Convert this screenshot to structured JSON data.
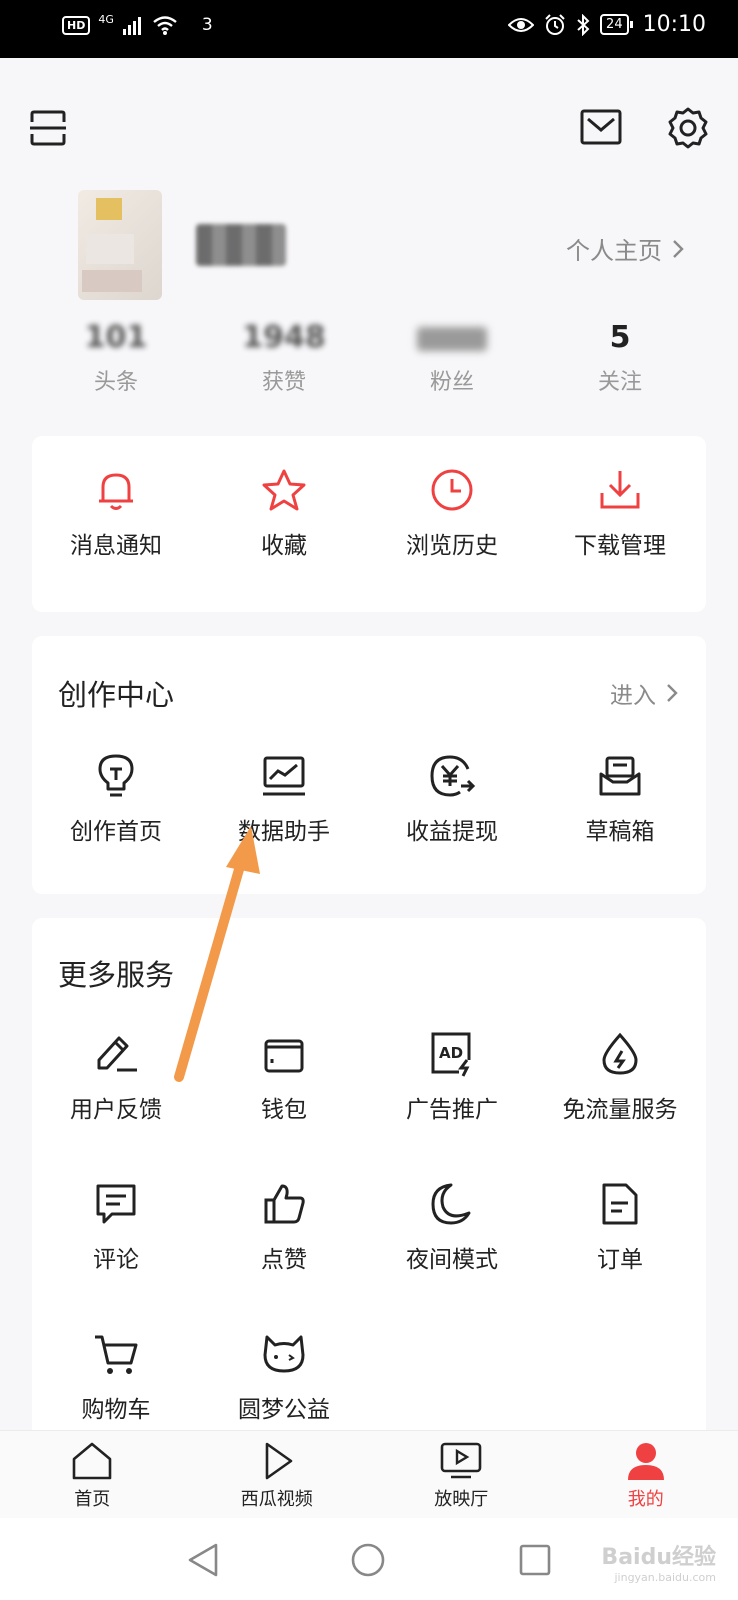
{
  "status_bar": {
    "hd": "HD",
    "network": "4G",
    "sim_count": "3",
    "battery": "24",
    "time": "10:10"
  },
  "profile": {
    "username": "某某",
    "home_link": "个人主页"
  },
  "stats": [
    {
      "value": "101",
      "label": "头条"
    },
    {
      "value": "1948",
      "label": "获赞"
    },
    {
      "value": "",
      "label": "粉丝"
    },
    {
      "value": "5",
      "label": "关注"
    }
  ],
  "quick_actions": [
    {
      "label": "消息通知",
      "icon": "bell-icon"
    },
    {
      "label": "收藏",
      "icon": "star-icon"
    },
    {
      "label": "浏览历史",
      "icon": "clock-icon"
    },
    {
      "label": "下载管理",
      "icon": "download-icon"
    }
  ],
  "creator_center": {
    "title": "创作中心",
    "link": "进入",
    "items": [
      {
        "label": "创作首页",
        "icon": "lightbulb-icon"
      },
      {
        "label": "数据助手",
        "icon": "chart-monitor-icon"
      },
      {
        "label": "收益提现",
        "icon": "yuan-icon"
      },
      {
        "label": "草稿箱",
        "icon": "draft-box-icon"
      }
    ]
  },
  "more_services": {
    "title": "更多服务",
    "items": [
      {
        "label": "用户反馈",
        "icon": "pencil-icon"
      },
      {
        "label": "钱包",
        "icon": "wallet-icon"
      },
      {
        "label": "广告推广",
        "icon": "ad-icon"
      },
      {
        "label": "免流量服务",
        "icon": "drop-icon"
      },
      {
        "label": "评论",
        "icon": "comment-icon"
      },
      {
        "label": "点赞",
        "icon": "thumbs-up-icon"
      },
      {
        "label": "夜间模式",
        "icon": "moon-icon"
      },
      {
        "label": "订单",
        "icon": "order-icon"
      },
      {
        "label": "购物车",
        "icon": "cart-icon"
      },
      {
        "label": "圆梦公益",
        "icon": "cat-face-icon"
      }
    ]
  },
  "tabs": [
    {
      "label": "首页",
      "icon": "home-icon"
    },
    {
      "label": "西瓜视频",
      "icon": "play-icon"
    },
    {
      "label": "放映厅",
      "icon": "tv-icon"
    },
    {
      "label": "我的",
      "icon": "person-icon",
      "active": true
    }
  ],
  "watermark": {
    "brand": "Baidu经验",
    "url": "jingyan.baidu.com"
  },
  "colors": {
    "accent": "#f04142",
    "annotation_arrow": "#f39a4a"
  }
}
